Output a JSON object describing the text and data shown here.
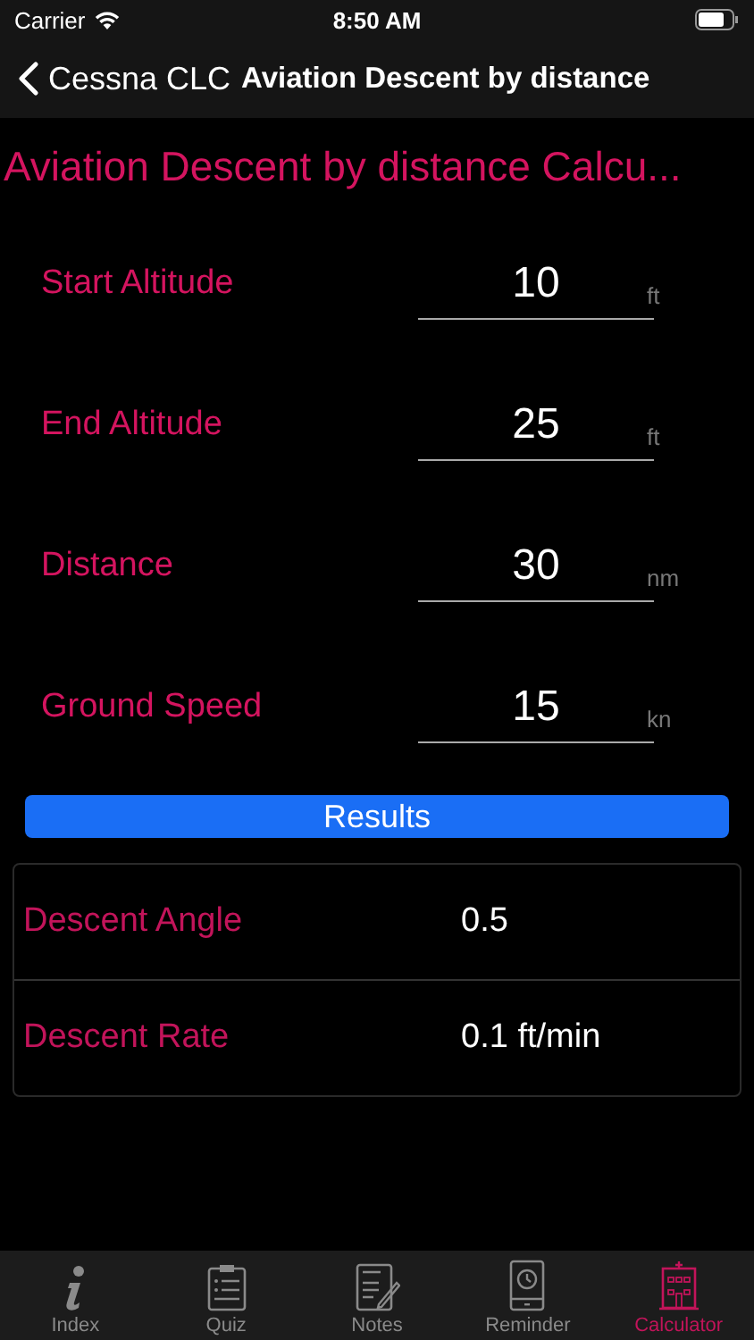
{
  "status_bar": {
    "carrier": "Carrier",
    "time": "8:50 AM"
  },
  "nav": {
    "back": "Cessna CLC",
    "title": "Aviation Descent by distance"
  },
  "heading": "Aviation Descent by distance Calcu...",
  "inputs": [
    {
      "label": "Start Altitude",
      "value": "10",
      "unit": "ft"
    },
    {
      "label": "End Altitude",
      "value": "25",
      "unit": "ft"
    },
    {
      "label": "Distance",
      "value": "30",
      "unit": "nm"
    },
    {
      "label": "Ground Speed",
      "value": "15",
      "unit": "kn"
    }
  ],
  "results_button": "Results",
  "results": [
    {
      "label": "Descent Angle",
      "value": "0.5"
    },
    {
      "label": "Descent Rate",
      "value": "0.1 ft/min"
    }
  ],
  "tabs": [
    {
      "kind": "info",
      "label": "Index",
      "selected": false
    },
    {
      "kind": "clipboard",
      "label": "Quiz",
      "selected": false
    },
    {
      "kind": "notes",
      "label": "Notes",
      "selected": false
    },
    {
      "kind": "clock",
      "label": "Reminder",
      "selected": false
    },
    {
      "kind": "building",
      "label": "Calculator",
      "selected": true
    }
  ]
}
